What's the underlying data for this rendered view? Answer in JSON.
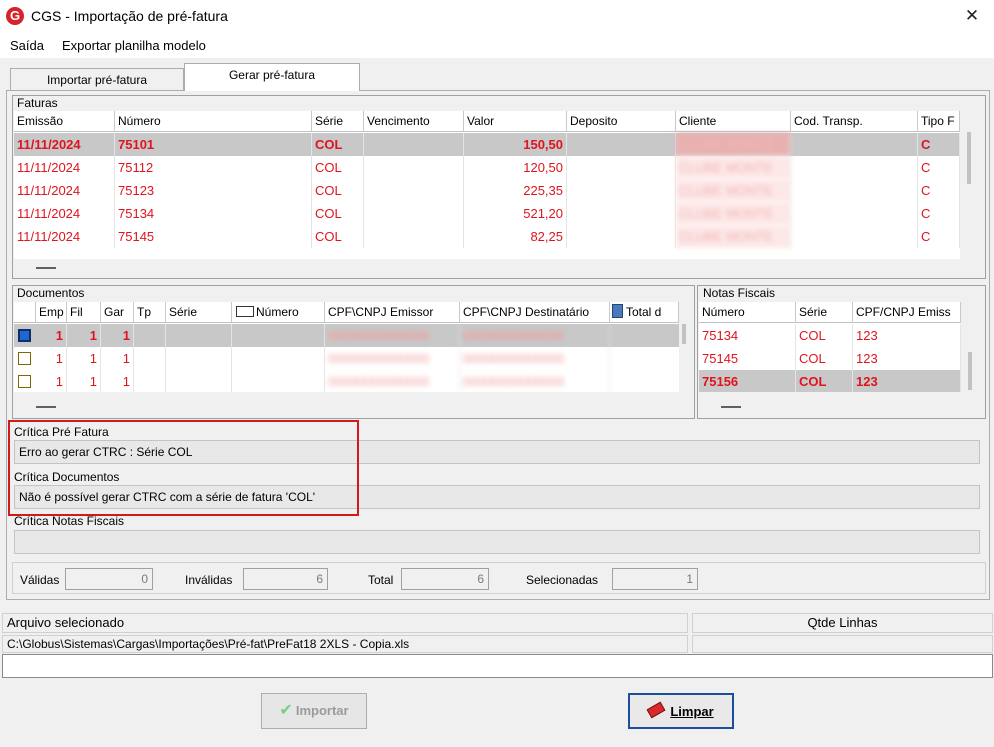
{
  "window": {
    "title": "CGS - Importação de pré-fatura",
    "app_icon": "G"
  },
  "menu": [
    "Saída",
    "Exportar planilha modelo"
  ],
  "tabs": [
    {
      "label": "Importar pré-fatura",
      "active": false
    },
    {
      "label": "Gerar pré-fatura",
      "active": true
    }
  ],
  "faturas": {
    "label": "Faturas",
    "columns": [
      "Emissão",
      "Número",
      "Série",
      "Vencimento",
      "Valor",
      "Deposito",
      "Cliente",
      "Cod. Transp.",
      "Tipo F"
    ],
    "rows": [
      {
        "emissao": "11/11/2024",
        "numero": "75101",
        "serie": "COL",
        "vencimento": "",
        "valor": "150,50",
        "deposito": "",
        "cliente": "CLUBE MONTE",
        "cod_transp": "",
        "tipo": "C",
        "selected": true
      },
      {
        "emissao": "11/11/2024",
        "numero": "75112",
        "serie": "COL",
        "vencimento": "",
        "valor": "120,50",
        "deposito": "",
        "cliente": "CLUBE MONTE",
        "cod_transp": "",
        "tipo": "C",
        "selected": false
      },
      {
        "emissao": "11/11/2024",
        "numero": "75123",
        "serie": "COL",
        "vencimento": "",
        "valor": "225,35",
        "deposito": "",
        "cliente": "CLUBE MONTE",
        "cod_transp": "",
        "tipo": "C",
        "selected": false
      },
      {
        "emissao": "11/11/2024",
        "numero": "75134",
        "serie": "COL",
        "vencimento": "",
        "valor": "521,20",
        "deposito": "",
        "cliente": "CLUBE MONTE",
        "cod_transp": "",
        "tipo": "C",
        "selected": false
      },
      {
        "emissao": "11/11/2024",
        "numero": "75145",
        "serie": "COL",
        "vencimento": "",
        "valor": "82,25",
        "deposito": "",
        "cliente": "CLUBE MONTE",
        "cod_transp": "",
        "tipo": "C",
        "selected": false
      }
    ]
  },
  "documentos": {
    "label": "Documentos",
    "columns": [
      "",
      "Emp",
      "Fil",
      "Gar",
      "Tp",
      "Série",
      "Número",
      "CPF\\CNPJ Emissor",
      "CPF\\CNPJ Destinatário",
      "Total d"
    ],
    "rows": [
      {
        "checked": true,
        "emp": "1",
        "fil": "1",
        "gar": "1",
        "tp": "",
        "serie": "",
        "numero": "",
        "emissor": "00000000000000",
        "destinatario": "00000000000000",
        "selected": true
      },
      {
        "checked": false,
        "emp": "1",
        "fil": "1",
        "gar": "1",
        "tp": "",
        "serie": "",
        "numero": "",
        "emissor": "00000000000000",
        "destinatario": "00000000000000",
        "selected": false
      },
      {
        "checked": false,
        "emp": "1",
        "fil": "1",
        "gar": "1",
        "tp": "",
        "serie": "",
        "numero": "",
        "emissor": "00000000000000",
        "destinatario": "00000000000000",
        "selected": false
      }
    ]
  },
  "notas": {
    "label": "Notas Fiscais",
    "columns": [
      "Número",
      "Série",
      "CPF/CNPJ Emiss"
    ],
    "rows": [
      {
        "numero": "75134",
        "serie": "COL",
        "cnpj": "123",
        "selected": false
      },
      {
        "numero": "75145",
        "serie": "COL",
        "cnpj": "123",
        "selected": false
      },
      {
        "numero": "75156",
        "serie": "COL",
        "cnpj": "123",
        "selected": true
      }
    ]
  },
  "critica": {
    "pre_fatura_label": "Crítica Pré Fatura",
    "pre_fatura_text": "Erro ao gerar CTRC : Série COL",
    "documentos_label": "Crítica Documentos",
    "documentos_text": "Não é possível gerar CTRC com a série de fatura 'COL'",
    "notas_label": "Crítica Notas Fiscais",
    "notas_text": ""
  },
  "counters": {
    "validas_label": "Válidas",
    "validas": "0",
    "invalidas_label": "Inválidas",
    "invalidas": "6",
    "total_label": "Total",
    "total": "6",
    "selecionadas_label": "Selecionadas",
    "selecionadas": "1"
  },
  "arquivo": {
    "label": "Arquivo selecionado",
    "path": "C:\\Globus\\Sistemas\\Cargas\\Importações\\Pré-fat\\PreFat18 2XLS - Copia.xls",
    "qtde_label": "Qtde Linhas",
    "qtde_value": ""
  },
  "buttons": {
    "importar": "Importar",
    "limpar": "Limpar"
  },
  "colors": {
    "accent_red": "#e0141e",
    "selected_row": "#c8c8c8",
    "highlight_box": "#d11a1a"
  }
}
